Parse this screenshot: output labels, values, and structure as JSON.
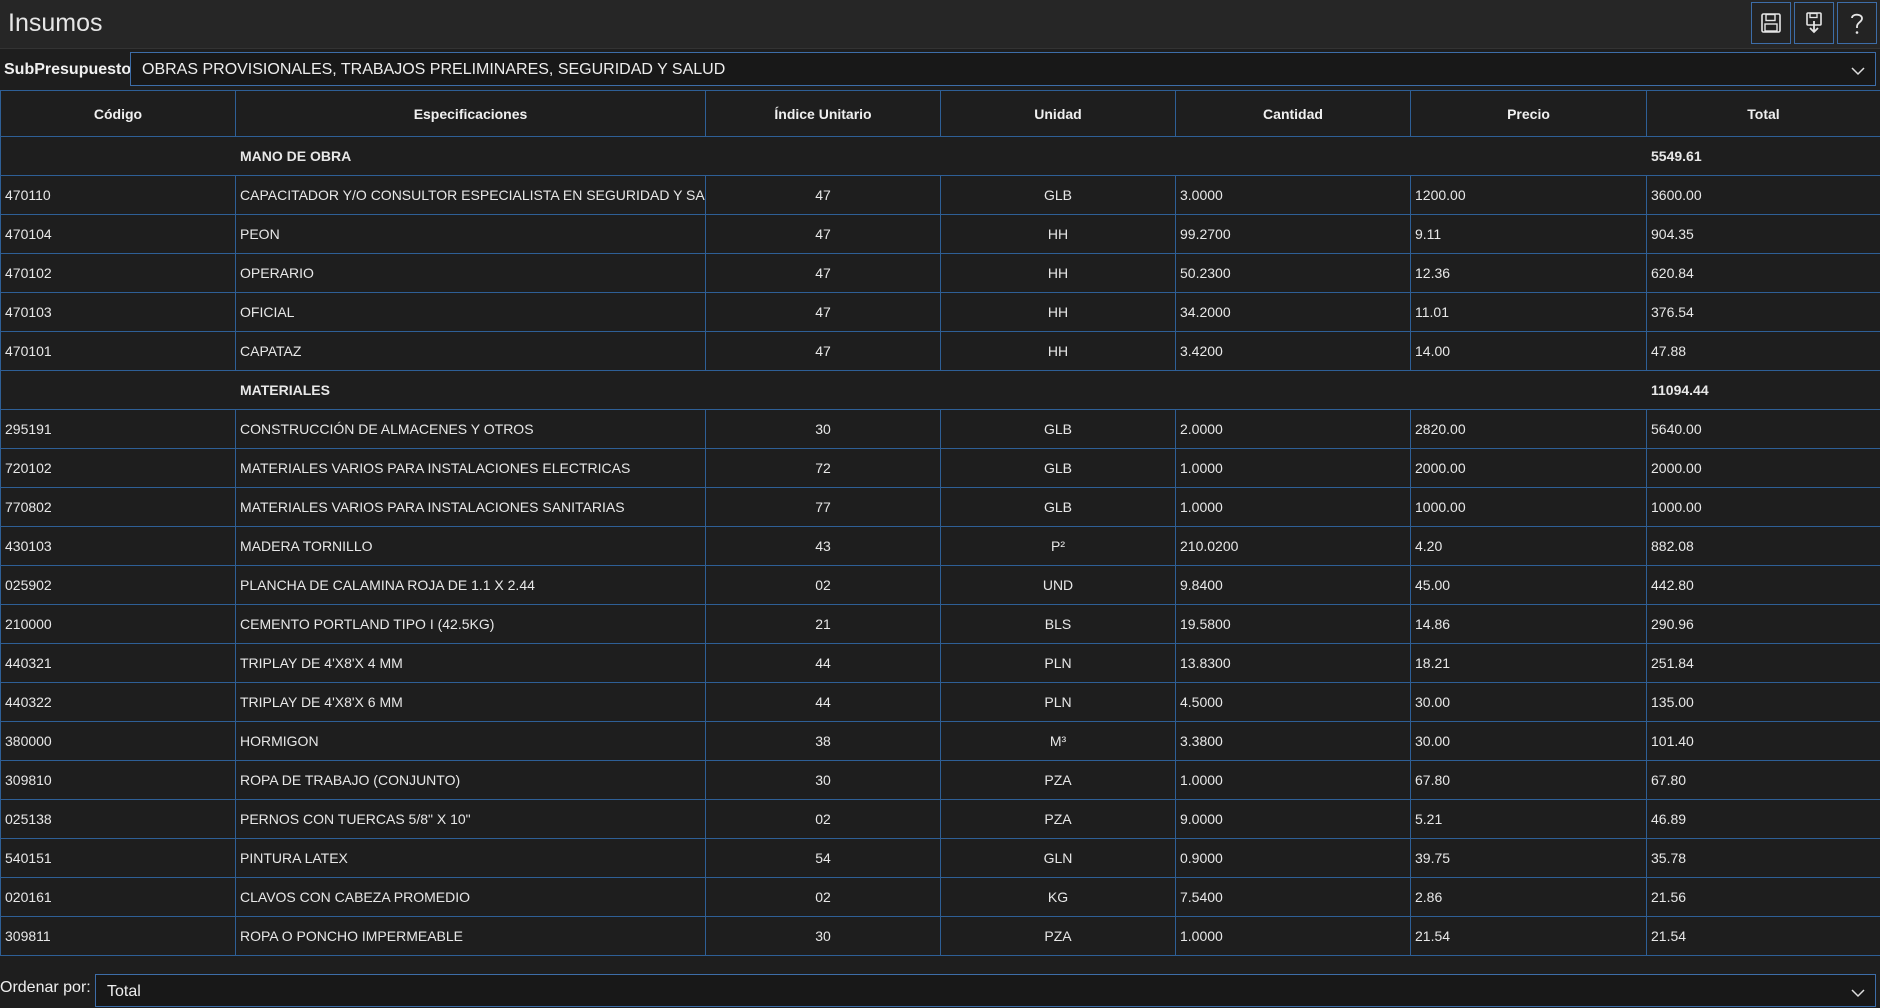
{
  "window": {
    "title": "Insumos"
  },
  "toolbar": {
    "icons": [
      "save-icon",
      "download-icon",
      "help-icon"
    ]
  },
  "subpresupuesto": {
    "label": "SubPresupuesto:",
    "value": "OBRAS PROVISIONALES, TRABAJOS PRELIMINARES, SEGURIDAD Y SALUD"
  },
  "table": {
    "headers": {
      "codigo": "Código",
      "especificaciones": "Especificaciones",
      "indice": "Índice Unitario",
      "unidad": "Unidad",
      "cantidad": "Cantidad",
      "precio": "Precio",
      "total": "Total"
    },
    "groups": [
      {
        "name": "MANO DE OBRA",
        "total": "5549.61",
        "rows": [
          {
            "codigo": "470110",
            "especificacion": "CAPACITADOR Y/O CONSULTOR ESPECIALISTA EN SEGURIDAD Y SALUD",
            "indice": "47",
            "unidad": "GLB",
            "cantidad": "3.0000",
            "precio": "1200.00",
            "total": "3600.00"
          },
          {
            "codigo": "470104",
            "especificacion": "PEON",
            "indice": "47",
            "unidad": "HH",
            "cantidad": "99.2700",
            "precio": "9.11",
            "total": "904.35"
          },
          {
            "codigo": "470102",
            "especificacion": "OPERARIO",
            "indice": "47",
            "unidad": "HH",
            "cantidad": "50.2300",
            "precio": "12.36",
            "total": "620.84"
          },
          {
            "codigo": "470103",
            "especificacion": "OFICIAL",
            "indice": "47",
            "unidad": "HH",
            "cantidad": "34.2000",
            "precio": "11.01",
            "total": "376.54"
          },
          {
            "codigo": "470101",
            "especificacion": "CAPATAZ",
            "indice": "47",
            "unidad": "HH",
            "cantidad": "3.4200",
            "precio": "14.00",
            "total": "47.88"
          }
        ]
      },
      {
        "name": "MATERIALES",
        "total": "11094.44",
        "rows": [
          {
            "codigo": "295191",
            "especificacion": "CONSTRUCCIÓN DE ALMACENES Y OTROS",
            "indice": "30",
            "unidad": "GLB",
            "cantidad": "2.0000",
            "precio": "2820.00",
            "total": "5640.00"
          },
          {
            "codigo": "720102",
            "especificacion": "MATERIALES VARIOS PARA INSTALACIONES ELECTRICAS",
            "indice": "72",
            "unidad": "GLB",
            "cantidad": "1.0000",
            "precio": "2000.00",
            "total": "2000.00"
          },
          {
            "codigo": "770802",
            "especificacion": "MATERIALES VARIOS PARA INSTALACIONES SANITARIAS",
            "indice": "77",
            "unidad": "GLB",
            "cantidad": "1.0000",
            "precio": "1000.00",
            "total": "1000.00"
          },
          {
            "codigo": "430103",
            "especificacion": "MADERA TORNILLO",
            "indice": "43",
            "unidad": "P²",
            "cantidad": "210.0200",
            "precio": "4.20",
            "total": "882.08"
          },
          {
            "codigo": "025902",
            "especificacion": "PLANCHA DE CALAMINA ROJA DE 1.1 X 2.44",
            "indice": "02",
            "unidad": "UND",
            "cantidad": "9.8400",
            "precio": "45.00",
            "total": "442.80"
          },
          {
            "codigo": "210000",
            "especificacion": "CEMENTO PORTLAND TIPO I (42.5KG)",
            "indice": "21",
            "unidad": "BLS",
            "cantidad": "19.5800",
            "precio": "14.86",
            "total": "290.96"
          },
          {
            "codigo": "440321",
            "especificacion": "TRIPLAY DE 4'X8'X 4 MM",
            "indice": "44",
            "unidad": "PLN",
            "cantidad": "13.8300",
            "precio": "18.21",
            "total": "251.84"
          },
          {
            "codigo": "440322",
            "especificacion": "TRIPLAY DE 4'X8'X 6 MM",
            "indice": "44",
            "unidad": "PLN",
            "cantidad": "4.5000",
            "precio": "30.00",
            "total": "135.00"
          },
          {
            "codigo": "380000",
            "especificacion": "HORMIGON",
            "indice": "38",
            "unidad": "M³",
            "cantidad": "3.3800",
            "precio": "30.00",
            "total": "101.40"
          },
          {
            "codigo": "309810",
            "especificacion": "ROPA DE TRABAJO (CONJUNTO)",
            "indice": "30",
            "unidad": "PZA",
            "cantidad": "1.0000",
            "precio": "67.80",
            "total": "67.80"
          },
          {
            "codigo": "025138",
            "especificacion": "PERNOS CON TUERCAS 5/8\" X 10\"",
            "indice": "02",
            "unidad": "PZA",
            "cantidad": "9.0000",
            "precio": "5.21",
            "total": "46.89"
          },
          {
            "codigo": "540151",
            "especificacion": "PINTURA LATEX",
            "indice": "54",
            "unidad": "GLN",
            "cantidad": "0.9000",
            "precio": "39.75",
            "total": "35.78"
          },
          {
            "codigo": "020161",
            "especificacion": "CLAVOS CON CABEZA PROMEDIO",
            "indice": "02",
            "unidad": "KG",
            "cantidad": "7.5400",
            "precio": "2.86",
            "total": "21.56"
          },
          {
            "codigo": "309811",
            "especificacion": "ROPA O PONCHO IMPERMEABLE",
            "indice": "30",
            "unidad": "PZA",
            "cantidad": "1.0000",
            "precio": "21.54",
            "total": "21.54"
          }
        ]
      }
    ]
  },
  "ordenar": {
    "label": "Ordenar por:",
    "value": "Total"
  },
  "colors": {
    "background": "#1e1e1e",
    "border_accent": "#2e5f96",
    "text": "#e8e8e8"
  }
}
